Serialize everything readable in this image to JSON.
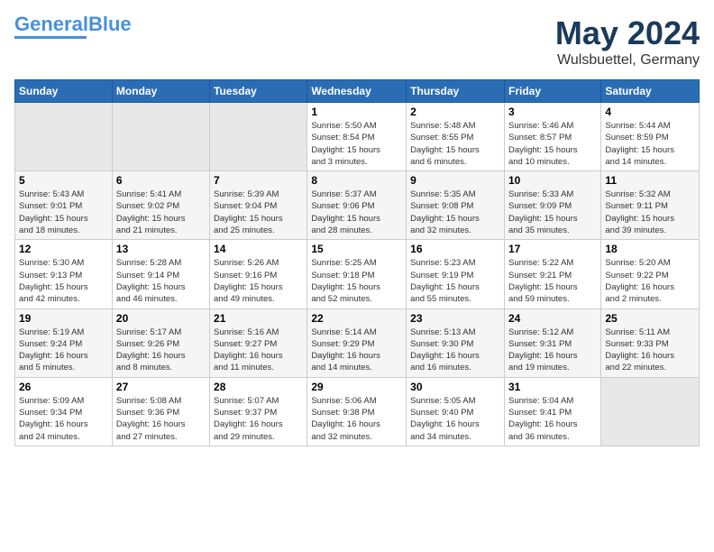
{
  "header": {
    "logo_line1a": "General",
    "logo_line1b": "Blue",
    "month": "May 2024",
    "location": "Wulsbuettel, Germany"
  },
  "days_of_week": [
    "Sunday",
    "Monday",
    "Tuesday",
    "Wednesday",
    "Thursday",
    "Friday",
    "Saturday"
  ],
  "weeks": [
    [
      {
        "day": "",
        "info": ""
      },
      {
        "day": "",
        "info": ""
      },
      {
        "day": "",
        "info": ""
      },
      {
        "day": "1",
        "info": "Sunrise: 5:50 AM\nSunset: 8:54 PM\nDaylight: 15 hours\nand 3 minutes."
      },
      {
        "day": "2",
        "info": "Sunrise: 5:48 AM\nSunset: 8:55 PM\nDaylight: 15 hours\nand 6 minutes."
      },
      {
        "day": "3",
        "info": "Sunrise: 5:46 AM\nSunset: 8:57 PM\nDaylight: 15 hours\nand 10 minutes."
      },
      {
        "day": "4",
        "info": "Sunrise: 5:44 AM\nSunset: 8:59 PM\nDaylight: 15 hours\nand 14 minutes."
      }
    ],
    [
      {
        "day": "5",
        "info": "Sunrise: 5:43 AM\nSunset: 9:01 PM\nDaylight: 15 hours\nand 18 minutes."
      },
      {
        "day": "6",
        "info": "Sunrise: 5:41 AM\nSunset: 9:02 PM\nDaylight: 15 hours\nand 21 minutes."
      },
      {
        "day": "7",
        "info": "Sunrise: 5:39 AM\nSunset: 9:04 PM\nDaylight: 15 hours\nand 25 minutes."
      },
      {
        "day": "8",
        "info": "Sunrise: 5:37 AM\nSunset: 9:06 PM\nDaylight: 15 hours\nand 28 minutes."
      },
      {
        "day": "9",
        "info": "Sunrise: 5:35 AM\nSunset: 9:08 PM\nDaylight: 15 hours\nand 32 minutes."
      },
      {
        "day": "10",
        "info": "Sunrise: 5:33 AM\nSunset: 9:09 PM\nDaylight: 15 hours\nand 35 minutes."
      },
      {
        "day": "11",
        "info": "Sunrise: 5:32 AM\nSunset: 9:11 PM\nDaylight: 15 hours\nand 39 minutes."
      }
    ],
    [
      {
        "day": "12",
        "info": "Sunrise: 5:30 AM\nSunset: 9:13 PM\nDaylight: 15 hours\nand 42 minutes."
      },
      {
        "day": "13",
        "info": "Sunrise: 5:28 AM\nSunset: 9:14 PM\nDaylight: 15 hours\nand 46 minutes."
      },
      {
        "day": "14",
        "info": "Sunrise: 5:26 AM\nSunset: 9:16 PM\nDaylight: 15 hours\nand 49 minutes."
      },
      {
        "day": "15",
        "info": "Sunrise: 5:25 AM\nSunset: 9:18 PM\nDaylight: 15 hours\nand 52 minutes."
      },
      {
        "day": "16",
        "info": "Sunrise: 5:23 AM\nSunset: 9:19 PM\nDaylight: 15 hours\nand 55 minutes."
      },
      {
        "day": "17",
        "info": "Sunrise: 5:22 AM\nSunset: 9:21 PM\nDaylight: 15 hours\nand 59 minutes."
      },
      {
        "day": "18",
        "info": "Sunrise: 5:20 AM\nSunset: 9:22 PM\nDaylight: 16 hours\nand 2 minutes."
      }
    ],
    [
      {
        "day": "19",
        "info": "Sunrise: 5:19 AM\nSunset: 9:24 PM\nDaylight: 16 hours\nand 5 minutes."
      },
      {
        "day": "20",
        "info": "Sunrise: 5:17 AM\nSunset: 9:26 PM\nDaylight: 16 hours\nand 8 minutes."
      },
      {
        "day": "21",
        "info": "Sunrise: 5:16 AM\nSunset: 9:27 PM\nDaylight: 16 hours\nand 11 minutes."
      },
      {
        "day": "22",
        "info": "Sunrise: 5:14 AM\nSunset: 9:29 PM\nDaylight: 16 hours\nand 14 minutes."
      },
      {
        "day": "23",
        "info": "Sunrise: 5:13 AM\nSunset: 9:30 PM\nDaylight: 16 hours\nand 16 minutes."
      },
      {
        "day": "24",
        "info": "Sunrise: 5:12 AM\nSunset: 9:31 PM\nDaylight: 16 hours\nand 19 minutes."
      },
      {
        "day": "25",
        "info": "Sunrise: 5:11 AM\nSunset: 9:33 PM\nDaylight: 16 hours\nand 22 minutes."
      }
    ],
    [
      {
        "day": "26",
        "info": "Sunrise: 5:09 AM\nSunset: 9:34 PM\nDaylight: 16 hours\nand 24 minutes."
      },
      {
        "day": "27",
        "info": "Sunrise: 5:08 AM\nSunset: 9:36 PM\nDaylight: 16 hours\nand 27 minutes."
      },
      {
        "day": "28",
        "info": "Sunrise: 5:07 AM\nSunset: 9:37 PM\nDaylight: 16 hours\nand 29 minutes."
      },
      {
        "day": "29",
        "info": "Sunrise: 5:06 AM\nSunset: 9:38 PM\nDaylight: 16 hours\nand 32 minutes."
      },
      {
        "day": "30",
        "info": "Sunrise: 5:05 AM\nSunset: 9:40 PM\nDaylight: 16 hours\nand 34 minutes."
      },
      {
        "day": "31",
        "info": "Sunrise: 5:04 AM\nSunset: 9:41 PM\nDaylight: 16 hours\nand 36 minutes."
      },
      {
        "day": "",
        "info": ""
      }
    ]
  ]
}
